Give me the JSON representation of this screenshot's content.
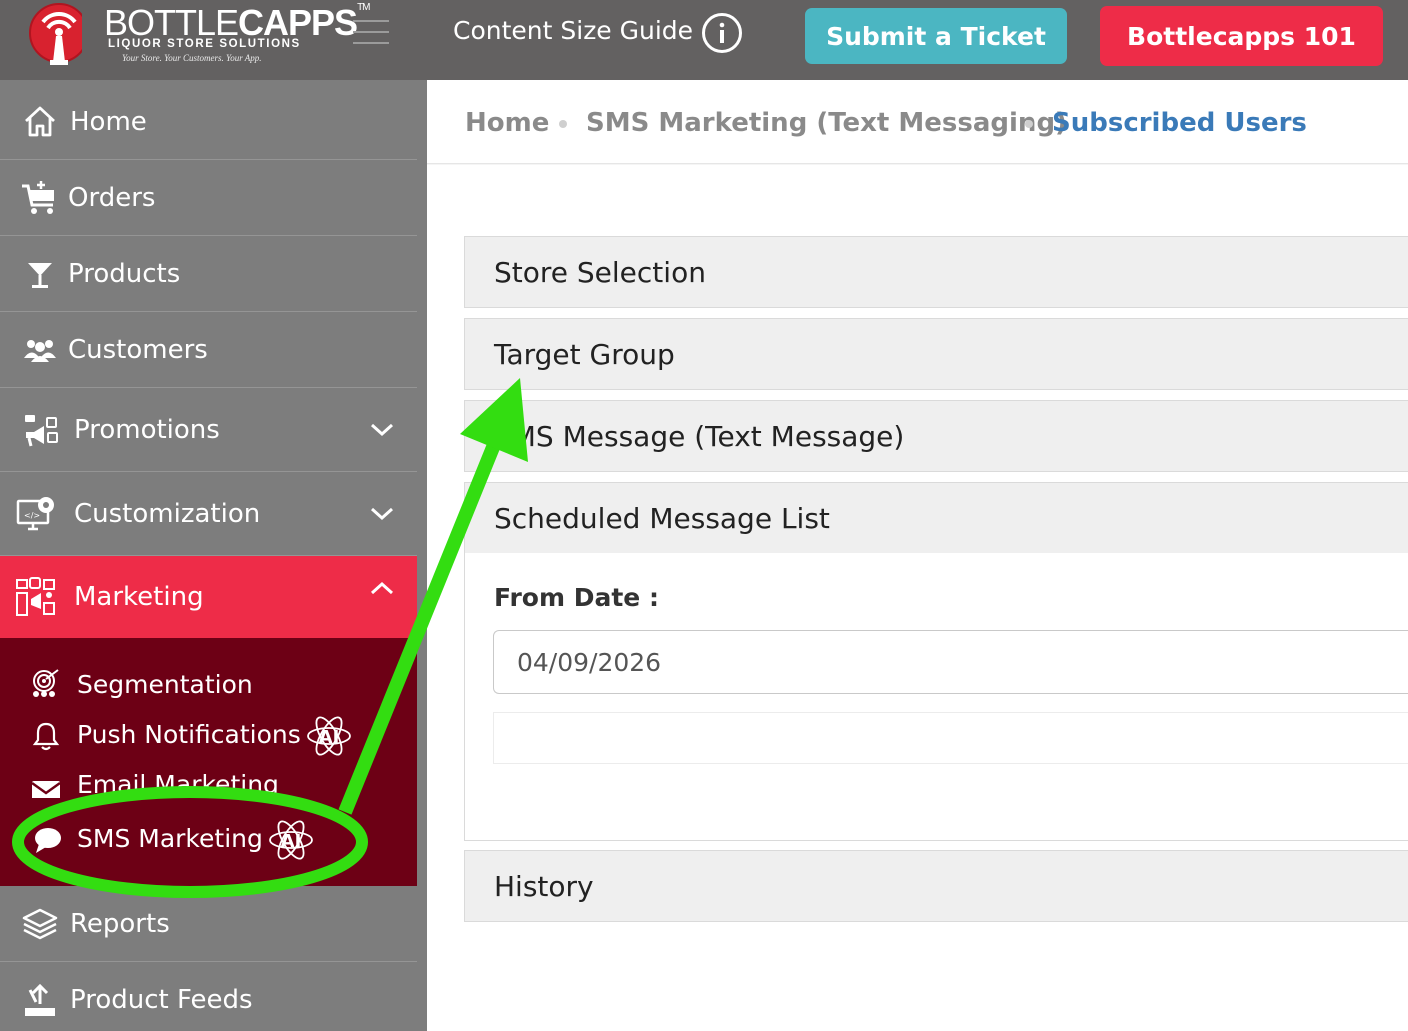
{
  "header": {
    "logo_title_light": "BOTTLE",
    "logo_title_bold": "CAPPS",
    "logo_tm": "TM",
    "logo_subtitle": "LIQUOR STORE SOLUTIONS",
    "logo_tagline": "Your Store. Your Customers. Your App.",
    "content_size_guide": "Content Size Guide",
    "submit_ticket": "Submit a Ticket",
    "bottlecapps_101": "Bottlecapps 101"
  },
  "sidebar": {
    "items": [
      {
        "label": "Home",
        "icon": "home-icon"
      },
      {
        "label": "Orders",
        "icon": "cart-icon"
      },
      {
        "label": "Products",
        "icon": "cocktail-glass-icon"
      },
      {
        "label": "Customers",
        "icon": "users-icon"
      },
      {
        "label": "Promotions",
        "icon": "megaphone-icon"
      },
      {
        "label": "Customization",
        "icon": "monitor-gear-icon"
      },
      {
        "label": "Marketing",
        "icon": "marketing-icon"
      }
    ],
    "marketing_sub": [
      {
        "label": "Segmentation",
        "icon": "target-users-icon"
      },
      {
        "label": "Push Notifications",
        "icon": "bell-icon"
      },
      {
        "label": "Email Marketing",
        "icon": "envelope-icon"
      },
      {
        "label": "SMS Marketing",
        "icon": "chat-bubble-icon"
      }
    ],
    "bottom_items": [
      {
        "label": "Reports",
        "icon": "layers-icon"
      },
      {
        "label": "Product Feeds",
        "icon": "upload-tray-icon"
      }
    ],
    "ai_badge": "AI"
  },
  "breadcrumb": {
    "home": "Home",
    "section": "SMS Marketing (Text Messaging)",
    "current": "Subscribed Users"
  },
  "panels": {
    "store_selection": "Store Selection",
    "target_group": "Target Group",
    "sms_message": "SMS Message (Text Message)",
    "scheduled_list": "Scheduled Message List",
    "history": "History"
  },
  "form": {
    "from_date_label": "From Date :",
    "from_date_value": "04/09/2026"
  },
  "colors": {
    "topbar": "#636161",
    "sidebar": "#7d7d7d",
    "active": "#ee2c48",
    "submenu": "#6d0015",
    "ticket_button": "#4bb6c2",
    "link": "#3a7ab8",
    "annotation": "#33dd11"
  }
}
